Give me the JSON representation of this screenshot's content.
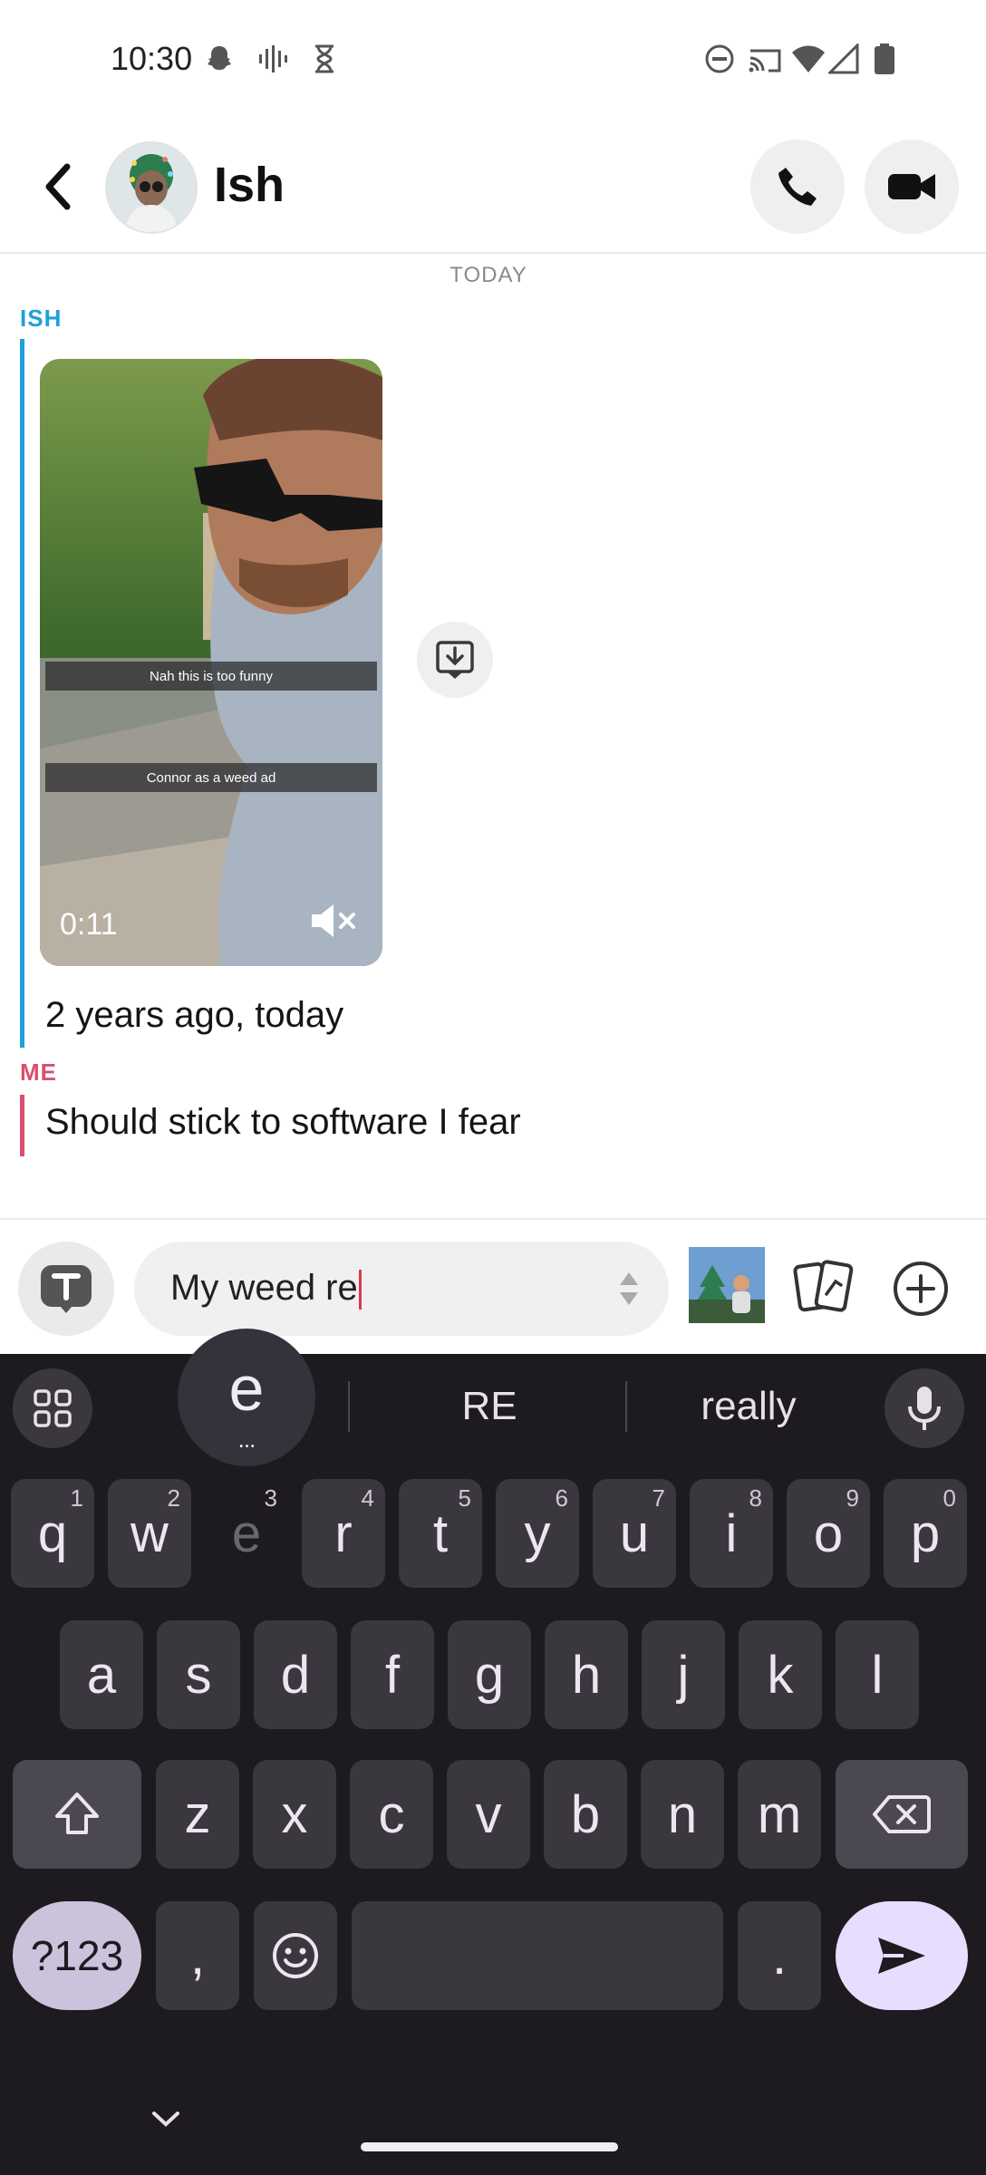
{
  "status_bar": {
    "time": "10:30"
  },
  "header": {
    "contact_name": "Ish"
  },
  "chat": {
    "date_label": "TODAY",
    "friend_label": "ISH",
    "video": {
      "caption_top": "Nah this is too funny",
      "caption_bottom": "Connor as a weed ad",
      "duration": "0:11"
    },
    "friend_message": "2 years ago, today",
    "me_label": "ME",
    "my_message": "Should stick to software I fear"
  },
  "composer": {
    "input_value": "My weed re"
  },
  "keyboard": {
    "suggestions": [
      "RE",
      "really"
    ],
    "popup_letter": "e",
    "popup_more": "...",
    "row1": [
      {
        "k": "q",
        "h": "1"
      },
      {
        "k": "w",
        "h": "2"
      },
      {
        "k": "e",
        "h": "3"
      },
      {
        "k": "r",
        "h": "4"
      },
      {
        "k": "t",
        "h": "5"
      },
      {
        "k": "y",
        "h": "6"
      },
      {
        "k": "u",
        "h": "7"
      },
      {
        "k": "i",
        "h": "8"
      },
      {
        "k": "o",
        "h": "9"
      },
      {
        "k": "p",
        "h": "0"
      }
    ],
    "row2": [
      "a",
      "s",
      "d",
      "f",
      "g",
      "h",
      "j",
      "k",
      "l"
    ],
    "row3": [
      "z",
      "x",
      "c",
      "v",
      "b",
      "n",
      "m"
    ],
    "symbols_label": "?123",
    "comma": ",",
    "period": "."
  },
  "colors": {
    "friend": "#1ea0d8",
    "me": "#d94f6e",
    "keyboard_bg": "#1d1b20",
    "key_bg": "#3a383e"
  }
}
